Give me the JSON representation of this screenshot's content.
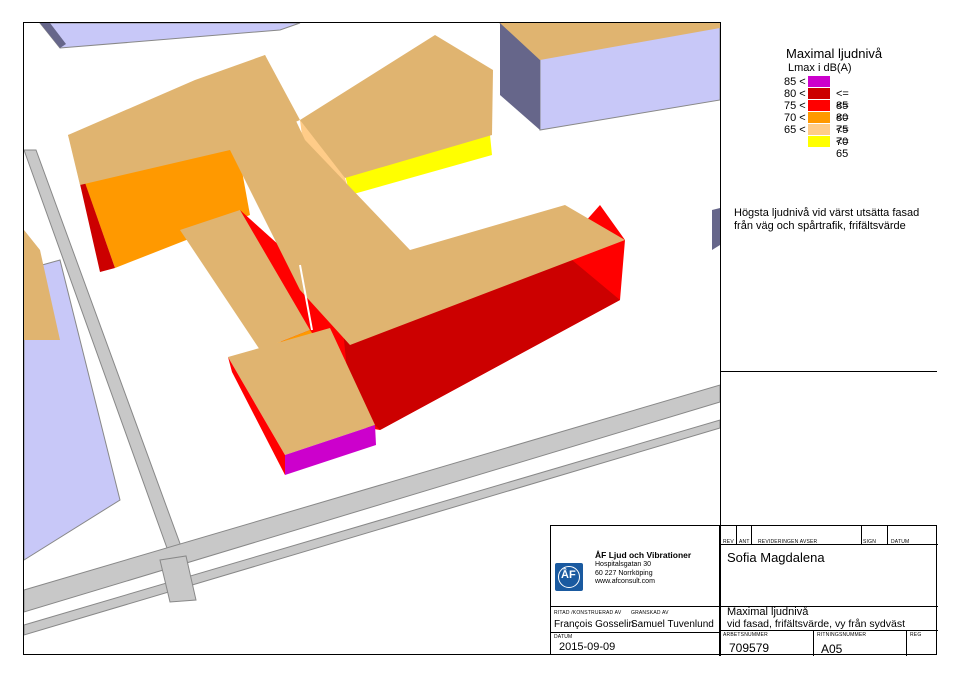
{
  "legend": {
    "title": "Maximal ljudnivå",
    "unit": "Lmax i dB(A)",
    "levels": [
      {
        "lower": "85 <",
        "upper": "",
        "color": "#CC00CC"
      },
      {
        "lower": "80 <",
        "upper": "<= 85",
        "color": "#CC0000"
      },
      {
        "lower": "75 <",
        "upper": "<= 80",
        "color": "#FF0000"
      },
      {
        "lower": "70 <",
        "upper": "<= 75",
        "color": "#FF9900"
      },
      {
        "lower": "65 <",
        "upper": "<= 70",
        "color": "#FFCC88"
      },
      {
        "lower": "",
        "upper": "<= 65",
        "color": "#FFFF00"
      }
    ],
    "description": "Högsta ljudnivå vid värst utsätta fasad från väg och spårtrafik, frifältsvärde"
  },
  "title_block": {
    "company": {
      "name": "ÅF Ljud och Vibrationer",
      "address": "Hospitalsgatan 30",
      "postal": "60 227 Norrköping",
      "web": "www.afconsult.com",
      "logo_text": "ÅF"
    },
    "headers": {
      "rev": "REV",
      "ant": "ANT",
      "revideringen": "REVIDERINGEN AVSER",
      "sign": "SIGN",
      "datum": "DATUM",
      "ritad": "RITAD /KONSTRUERAD AV",
      "granskad": "GRANSKAD AV",
      "datum2": "DATUM",
      "arbetsnummer": "ARBETSNUMMER",
      "ritningsnummer": "RITNINGSNUMMER",
      "reg": "REG"
    },
    "project": "Sofia Magdalena",
    "drawn_by": "François Gosselin",
    "checked_by": "Samuel Tuvenlund",
    "date": "2015-09-09",
    "drawing_title": "Maximal ljudnivå",
    "drawing_subtitle": "vid fasad, frifältsvärde, vy från sydväst",
    "work_number": "709579",
    "drawing_number": "A05"
  },
  "colors": {
    "roof": "#E0B470",
    "facade_orange": "#FF9900",
    "facade_red": "#FF0000",
    "facade_darkred": "#CC0000",
    "facade_magenta": "#CC00CC",
    "facade_yellow": "#FFFF00",
    "facade_light": "#FFCC88",
    "neighbor_face": "#C8C8F8",
    "neighbor_dark": "#66668A",
    "road": "#C8C8C8",
    "ground": "#FFFFFF"
  }
}
